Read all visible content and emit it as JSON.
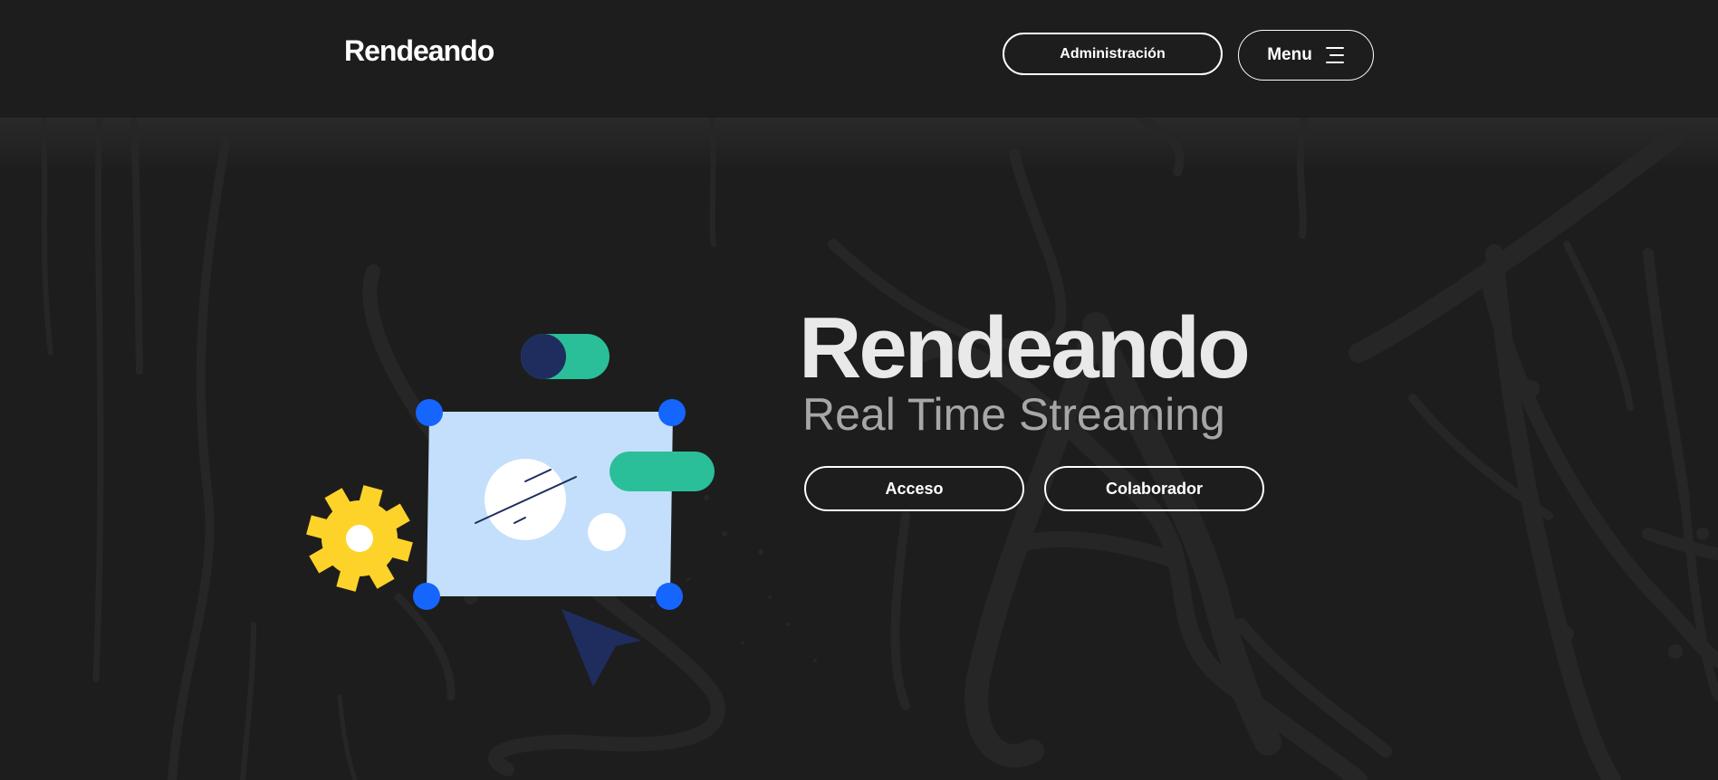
{
  "header": {
    "logo": "Rendeando",
    "admin_label": "Administración",
    "menu_label": "Menu"
  },
  "hero": {
    "title": "Rendeando",
    "subtitle": "Real Time Streaming",
    "buttons": {
      "acceso_label": "Acceso",
      "colaborador_label": "Colaborador"
    }
  },
  "icons": {
    "menu": "hamburger-icon",
    "illustration": "editor-canvas-illustration",
    "gear": "gear-icon",
    "toggle": "toggle-icon",
    "cursor": "cursor-arrow-icon"
  },
  "colors": {
    "background": "#1c1c1c",
    "header": "#1d1d1d",
    "canvas": "#c4dffb",
    "handle_blue": "#1565ff",
    "teal": "#2abf98",
    "navy": "#1e2d5e",
    "gear_yellow": "#fdd329",
    "title_text": "#e9e9e9",
    "subtitle_text": "#a7a7a7"
  }
}
